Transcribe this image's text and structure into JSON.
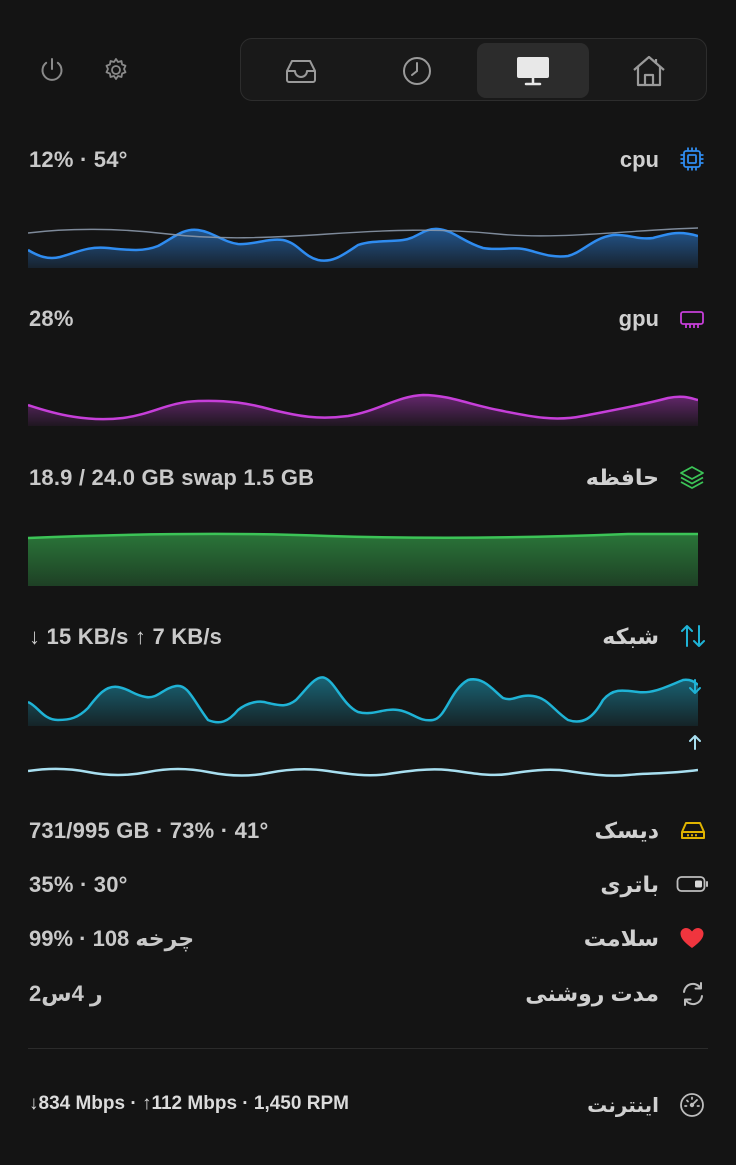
{
  "toolbar": {
    "icons": [
      "power-icon",
      "gear-icon"
    ],
    "tabs": [
      {
        "name": "inbox-tab",
        "icon": "inbox-tray-icon",
        "active": false
      },
      {
        "name": "history-tab",
        "icon": "clock-icon",
        "active": false
      },
      {
        "name": "system-tab",
        "icon": "monitor-icon",
        "active": true
      },
      {
        "name": "home-tab",
        "icon": "home-icon",
        "active": false
      }
    ]
  },
  "metrics": {
    "cpu": {
      "label": "cpu",
      "value": "12% · 54°",
      "color": "#2f8cf0"
    },
    "gpu": {
      "label": "gpu",
      "value": "28%",
      "color": "#c63fd9"
    },
    "memory": {
      "label": "حافظه",
      "value": "18.9 / 24.0 GB  swap 1.5 GB",
      "color": "#3cc457"
    },
    "network": {
      "label": "شبکه",
      "value": "↓ 15 KB/s   ↑ 7 KB/s",
      "color": "#1fb3d6",
      "upload_color": "#a8dff0"
    },
    "disk": {
      "label": "دیسک",
      "value": "731/995 GB · 73% · 41°",
      "color": "#e0b400"
    },
    "battery": {
      "label": "باتری",
      "value": "35% · 30°"
    },
    "health": {
      "label": "سلامت",
      "value": "99% · 108 چرخه",
      "color": "#f0353e"
    },
    "uptime": {
      "label": "مدت روشنی",
      "value": "2ر 4س"
    }
  },
  "footer": {
    "label": "اینترنت",
    "value": "↓834 Mbps · ↑112 Mbps · 1,450 RPM"
  }
}
